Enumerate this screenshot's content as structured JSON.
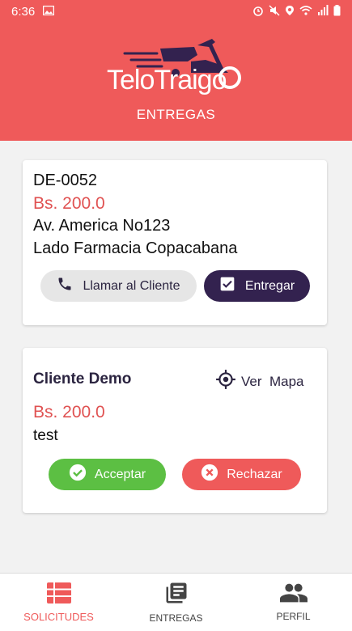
{
  "status_bar": {
    "time": "6:36"
  },
  "header": {
    "logo_text": "TeloTraigo",
    "subtitle": "ENTREGAS"
  },
  "order_card": {
    "code": "DE-0052",
    "price": "Bs. 200.0",
    "address": "Av. America No123",
    "reference": "Lado Farmacia Copacabana",
    "call_label": "Llamar al Cliente",
    "deliver_label": "Entregar"
  },
  "request_card": {
    "client_name": "Cliente Demo",
    "map_label": "Ver  Mapa",
    "price": "Bs. 200.0",
    "note": "test",
    "accept_label": "Acceptar",
    "reject_label": "Rechazar"
  },
  "bottom_nav": {
    "items": [
      {
        "label": "SOLICITUDES",
        "icon": "list-icon",
        "active": true
      },
      {
        "label": "ENTREGAS",
        "icon": "library-books-icon",
        "active": false
      },
      {
        "label": "PERFIL",
        "icon": "people-icon",
        "active": false
      }
    ]
  },
  "colors": {
    "brand_red": "#ef5a5a",
    "dark_purple": "#33224f",
    "accept_green": "#5cbf43"
  }
}
